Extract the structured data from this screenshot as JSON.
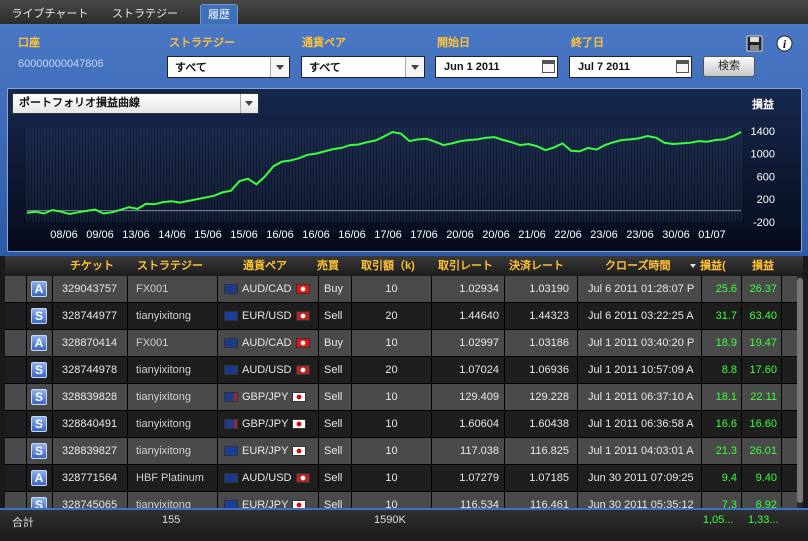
{
  "tabs": [
    {
      "label": "ライブチャート",
      "active": false
    },
    {
      "label": "ストラテジー",
      "active": false
    },
    {
      "label": "履歴",
      "active": true
    }
  ],
  "filters": {
    "account_label": "口座",
    "account_value": "60000000047806",
    "strategy_label": "ストラテジー",
    "strategy_value": "すべて",
    "pair_label": "通貨ペア",
    "pair_value": "すべて",
    "start_label": "開始日",
    "start_value": "Jun 1 2011",
    "end_label": "終了日",
    "end_value": "Jul 7 2011",
    "search_button": "検索"
  },
  "chart_selector": "ポートフォリオ損益曲線",
  "chart_data": {
    "type": "line",
    "ylabel": "損益",
    "ylim": [
      -200,
      1450
    ],
    "y_ticks": [
      "1400",
      "1000",
      "600",
      "200",
      "-200"
    ],
    "x_ticks": [
      "08/06",
      "09/06",
      "13/06",
      "14/06",
      "15/06",
      "15/06",
      "16/06",
      "16/06",
      "16/06",
      "17/06",
      "17/06",
      "20/06",
      "20/06",
      "21/06",
      "22/06",
      "23/06",
      "23/06",
      "30/06",
      "01/07"
    ],
    "series": [
      {
        "values": [
          -40,
          -20,
          -50,
          10,
          -20,
          -60,
          -30,
          -5,
          20,
          -50,
          -30,
          15,
          60,
          30,
          120,
          110,
          150,
          165,
          140,
          170,
          200,
          230,
          260,
          320,
          350,
          520,
          560,
          460,
          600,
          780,
          860,
          880,
          920,
          980,
          1000,
          1040,
          1080,
          1100,
          1150,
          1160,
          1200,
          1230,
          1300,
          1380,
          1350,
          1220,
          1250,
          1260,
          1210,
          1150,
          1180,
          1220,
          1240,
          1250,
          1280,
          1290,
          1240,
          1200,
          1150,
          1170,
          1130,
          1060,
          1110,
          1180,
          1050,
          1040,
          1100,
          1070,
          1150,
          1200,
          1240,
          1250,
          1270,
          1310,
          1280,
          1190,
          1170,
          1180,
          1190,
          1220,
          1210,
          1240,
          1250,
          1300,
          1380
        ]
      }
    ],
    "color": "#3bff3b"
  },
  "table": {
    "headers": [
      "チケット",
      "ストラテジー",
      "通貨ペア",
      "売買",
      "取引額（k)",
      "取引レート",
      "決済レート",
      "クローズ時間",
      "損益(",
      "損益"
    ],
    "rows": [
      {
        "badge": "A",
        "ticket": "329043757",
        "strategy": "FX001",
        "pair": "AUD/CAD",
        "flags": [
          "au",
          "ca"
        ],
        "side": "Buy",
        "amount": "10",
        "rate": "1.02934",
        "close_rate": "1.03190",
        "close_time": "Jul 6 2011 01:28:07 P",
        "pips": "25.6",
        "pl": "26.37",
        "shade": "light"
      },
      {
        "badge": "S",
        "ticket": "328744977",
        "strategy": "tianyixitong",
        "pair": "EUR/USD",
        "flags": [
          "eu",
          "us"
        ],
        "side": "Sell",
        "amount": "20",
        "rate": "1.44640",
        "close_rate": "1.44323",
        "close_time": "Jul 6 2011 03:22:25 A",
        "pips": "31.7",
        "pl": "63.40",
        "shade": "dark"
      },
      {
        "badge": "A",
        "ticket": "328870414",
        "strategy": "FX001",
        "pair": "AUD/CAD",
        "flags": [
          "au",
          "ca"
        ],
        "side": "Buy",
        "amount": "10",
        "rate": "1.02997",
        "close_rate": "1.03186",
        "close_time": "Jul 1 2011 03:40:20 P",
        "pips": "18.9",
        "pl": "19.47",
        "shade": "light"
      },
      {
        "badge": "S",
        "ticket": "328744978",
        "strategy": "tianyixitong",
        "pair": "AUD/USD",
        "flags": [
          "au",
          "us"
        ],
        "side": "Sell",
        "amount": "20",
        "rate": "1.07024",
        "close_rate": "1.06936",
        "close_time": "Jul 1 2011 10:57:09 A",
        "pips": "8.8",
        "pl": "17.60",
        "shade": "dark"
      },
      {
        "badge": "S",
        "ticket": "328839828",
        "strategy": "tianyixitong",
        "pair": "GBP/JPY",
        "flags": [
          "gb",
          "jp"
        ],
        "side": "Sell",
        "amount": "10",
        "rate": "129.409",
        "close_rate": "129.228",
        "close_time": "Jul 1 2011 06:37:10 A",
        "pips": "18.1",
        "pl": "22.11",
        "shade": "light"
      },
      {
        "badge": "S",
        "ticket": "328840491",
        "strategy": "tianyixitong",
        "pair": "GBP/JPY",
        "flags": [
          "gb",
          "jp"
        ],
        "side": "Sell",
        "amount": "10",
        "rate": "1.60604",
        "close_rate": "1.60438",
        "close_time": "Jul 1 2011 06:36:58 A",
        "pips": "16.6",
        "pl": "16.60",
        "shade": "dark"
      },
      {
        "badge": "S",
        "ticket": "328839827",
        "strategy": "tianyixitong",
        "pair": "EUR/JPY",
        "flags": [
          "eu",
          "jp"
        ],
        "side": "Sell",
        "amount": "10",
        "rate": "117.038",
        "close_rate": "116.825",
        "close_time": "Jul 1 2011 04:03:01 A",
        "pips": "21.3",
        "pl": "26.01",
        "shade": "light"
      },
      {
        "badge": "A",
        "ticket": "328771564",
        "strategy": "HBF Platinum",
        "pair": "AUD/USD",
        "flags": [
          "au",
          "us"
        ],
        "side": "Sell",
        "amount": "10",
        "rate": "1.07279",
        "close_rate": "1.07185",
        "close_time": "Jun 30 2011 07:09:25",
        "pips": "9.4",
        "pl": "9.40",
        "shade": "dark"
      },
      {
        "badge": "S",
        "ticket": "328745065",
        "strategy": "tianyixitong",
        "pair": "EUR/JPY",
        "flags": [
          "eu",
          "jp"
        ],
        "side": "Sell",
        "amount": "10",
        "rate": "116.534",
        "close_rate": "116.461",
        "close_time": "Jun 30 2011 05:35:12",
        "pips": "7.3",
        "pl": "8.92",
        "shade": "light"
      }
    ]
  },
  "footer": {
    "label": "合計",
    "count": "155",
    "amount": "1590K",
    "pips": "1,05...",
    "pl": "1,33..."
  },
  "colors": {
    "accent": "#ffc233",
    "profit": "#3bff3b",
    "panel": "#3f6fb7"
  }
}
